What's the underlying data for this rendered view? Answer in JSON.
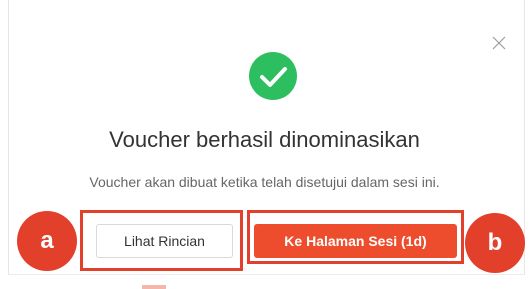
{
  "dialog": {
    "title": "Voucher berhasil dinominasikan",
    "subtitle": "Voucher akan dibuat ketika telah disetujui dalam sesi ini.",
    "close_icon": "close-icon",
    "success_icon": "check-circle-icon",
    "success_color": "#2dbe60",
    "buttons": {
      "secondary_label": "Lihat Rincian",
      "primary_label": "Ke Halaman Sesi (1d)",
      "primary_color": "#ee4d2d"
    }
  },
  "annotations": {
    "a_label": "a",
    "b_label": "b",
    "color": "#e3402c"
  }
}
